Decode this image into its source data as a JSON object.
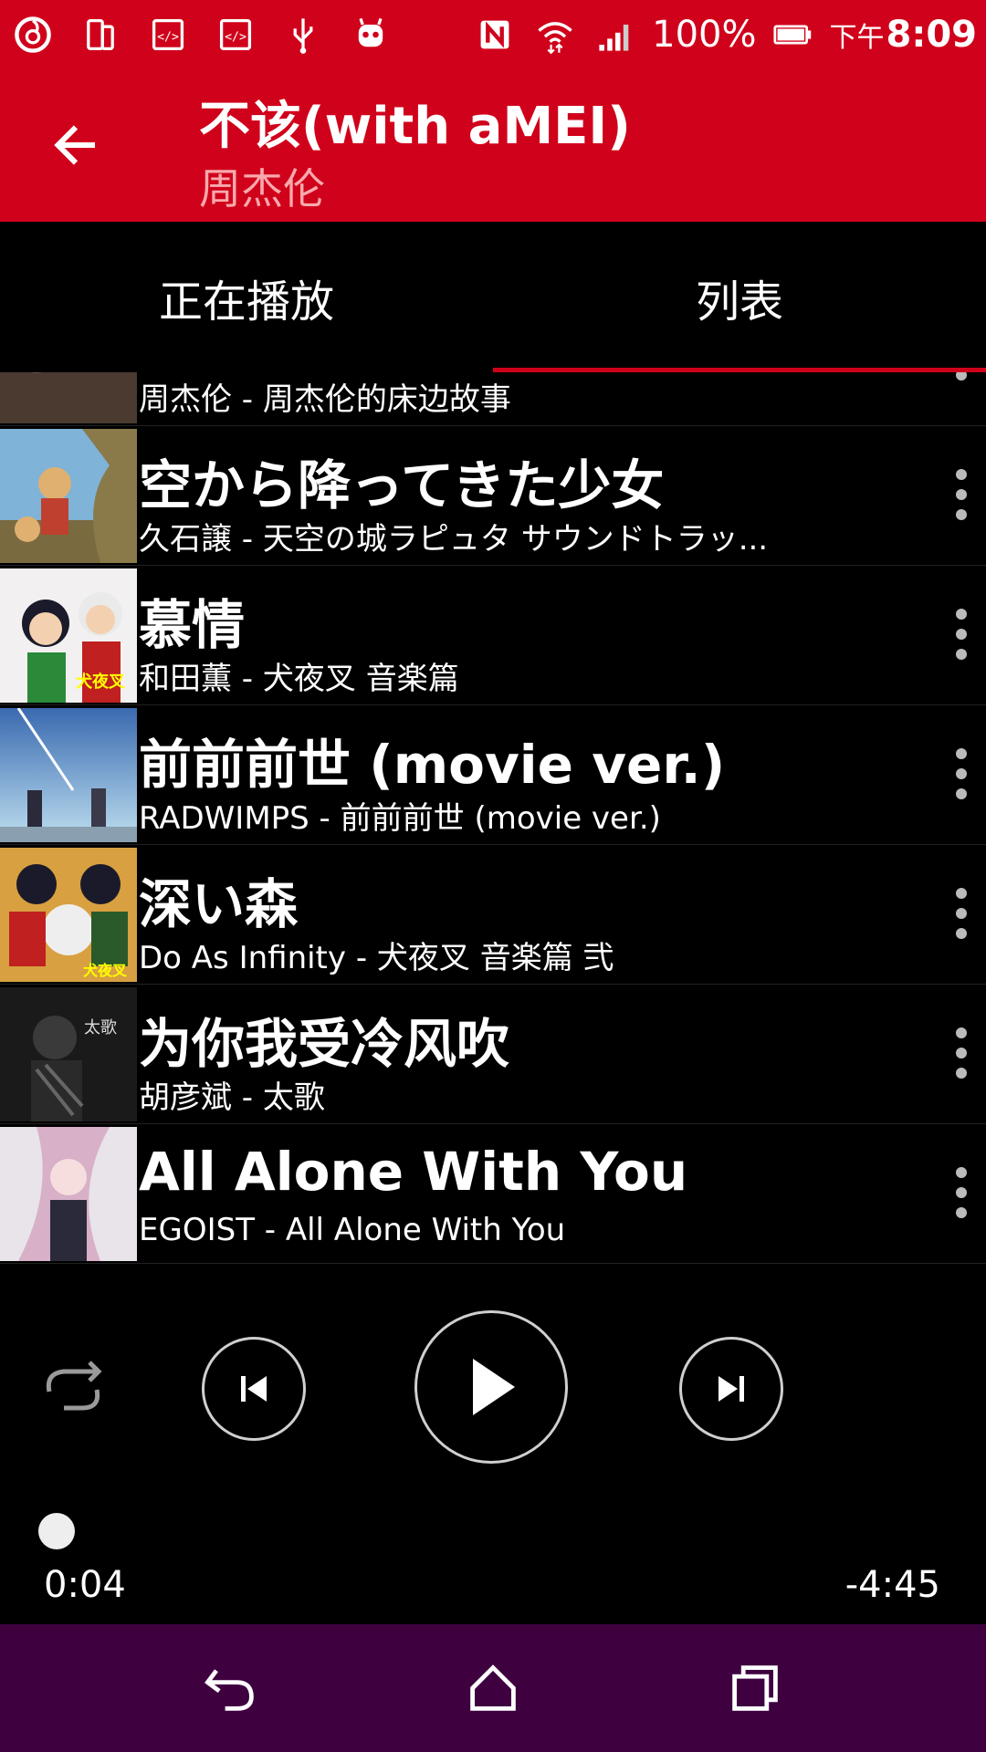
{
  "status_bar": {
    "battery": "100%",
    "time_prefix": "下午",
    "time": "8:09",
    "icons": [
      "netease-music-icon",
      "dual-screen-icon",
      "code-icon",
      "code-icon",
      "usb-icon",
      "robot-icon",
      "nfc-icon",
      "wifi-icon",
      "signal-icon",
      "battery-icon"
    ]
  },
  "toolbar": {
    "title": "不该(with aMEI)",
    "subtitle": "周杰伦"
  },
  "tabs": [
    {
      "label": "正在播放"
    },
    {
      "label": "列表"
    }
  ],
  "songs": [
    {
      "title": "不该(with aMEI)",
      "subtitle": "周杰伦 - 周杰伦的床边故事"
    },
    {
      "title": "空から降ってきた少女",
      "subtitle": "久石譲 - 天空の城ラピュタ サウンドトラッ..."
    },
    {
      "title": "慕情",
      "subtitle": "和田薫 - 犬夜叉 音楽篇"
    },
    {
      "title": "前前前世 (movie ver.)",
      "subtitle": "RADWIMPS - 前前前世 (movie ver.)"
    },
    {
      "title": "深い森",
      "subtitle": "Do As Infinity - 犬夜叉 音楽篇 弐"
    },
    {
      "title": "为你我受冷风吹",
      "subtitle": "胡彦斌 - 太歌"
    },
    {
      "title": "All Alone With You",
      "subtitle": "EGOIST - All Alone With You"
    }
  ],
  "player": {
    "time_current": "0:04",
    "time_remaining": "-4:45",
    "progress_fraction": 0.015
  },
  "colors": {
    "accent": "#d0021b",
    "nav_bg": "#3f0040",
    "subtitle": "#f8a9ad"
  }
}
